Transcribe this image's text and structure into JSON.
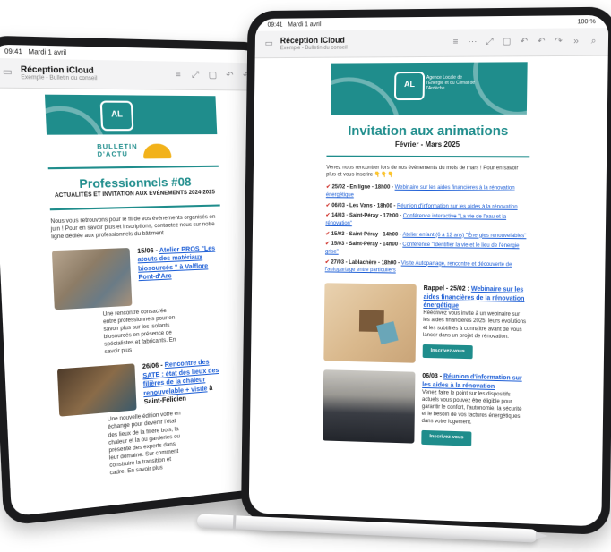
{
  "colors": {
    "teal": "#1f8d8c",
    "link": "#1e5fd6",
    "marker": "#d0342c",
    "helmet": "#f2b21a"
  },
  "back_tablet": {
    "status": {
      "time": "09:41",
      "date": "Mardi 1 avril"
    },
    "toolbar": {
      "mailbox_title": "Réception iCloud",
      "mailbox_sub": "Exemple - Bulletin du conseil"
    },
    "email": {
      "bulletin_line1": "BULLETIN",
      "bulletin_line2": "D'ACTU",
      "title": "Professionnels #08",
      "subtitle": "ACTUALITÉS ET INVITATION AUX ÉVÉNEMENTS 2024-2025",
      "intro": "Nous vous retrouvons pour le fil de vos événements organisés en juin ! Pour en savoir plus et inscriptions, contactez nous sur notre ligne dédiée aux professionnels du bâtiment",
      "articles": [
        {
          "date": "15/06 - ",
          "link": "Atelier PROS \"Les atouts des matériaux biosourcés \" à Valflore Pont-d'Arc",
          "text": "Une rencontre consacrée entre professionnels pour en savoir plus sur les isolants biosourcés en présence de spécialistes et fabricants. En savoir plus"
        },
        {
          "date": "26/06 - ",
          "link": "Rencontre des SATE : état des lieux des filières de la chaleur renouvelable + visite",
          "place": "à Saint-Félicien",
          "text": "Une nouvelle édition votre en échange pour devenir l'état des lieux de la filière bois, la chaleur et la ou garderies ou présente des experts dans leur domaine. Sur comment construire la transition et cadre. En savoir plus"
        }
      ]
    }
  },
  "front_tablet": {
    "status": {
      "time": "09:41",
      "date": "Mardi 1 avril",
      "battery": "100 %"
    },
    "toolbar": {
      "mailbox_title": "Réception iCloud",
      "mailbox_sub": "Exemple - Bulletin du conseil"
    },
    "email": {
      "logo_text": "Agence Locale de l'Énergie et du Climat de l'Ardèche",
      "title": "Invitation aux animations",
      "subtitle": "Février - Mars 2025",
      "intro": "Venez nous rencontrer lors de nos évènements du mois de mars ! Pour en savoir plus et vous inscrire",
      "intro_emoji": "👇👇👇",
      "events": [
        {
          "date": "25/02 - En ligne - 18h00 - ",
          "link": "Webinaire sur les aides financières à la rénovation énergétique"
        },
        {
          "date": "06/03 - Les Vans - 18h00 - ",
          "link": "Réunion d'information sur les aides à la rénovation"
        },
        {
          "date": "14/03 - Saint-Péray - 17h00 - ",
          "link": "Conférence interactive \"La vie de l'eau et la rénovation\""
        },
        {
          "date": "15/03 - Saint-Péray - 14h00 - ",
          "link": "Atelier enfant (6 à 12 ans) \"Énergies renouvelables\""
        },
        {
          "date": "15/03 - Saint-Péray - 14h00 - ",
          "link": "Conférence \"Identifier la vie et le lieu de l'énergie grise\""
        },
        {
          "date": "27/03 - Lablachère - 18h00 - ",
          "link": "Visite Autopartage, rencontre et découverte de l'autopartage entre particuliers"
        }
      ],
      "cards": [
        {
          "date": "Rappel - 25/02 : ",
          "link": "Webinaire sur les aides financières de la rénovation énergétique",
          "text": "Réécrivez vous invite à un webinaire sur les aides financières 2025, leurs évolutions et les subtilités à connaître avant de vous lancer dans un projet de rénovation.",
          "button": "Inscrivez-vous"
        },
        {
          "date": "06/03 - ",
          "link": "Réunion d'information sur les aides à la rénovation",
          "text": "Venez faire le point sur les dispositifs actuels vous pouvez être éligible pour garantir le confort, l'autonomie, la sécurité et le besoin de vos factures énergétiques dans votre logement.",
          "button": "Inscrivez-vous"
        }
      ]
    }
  }
}
